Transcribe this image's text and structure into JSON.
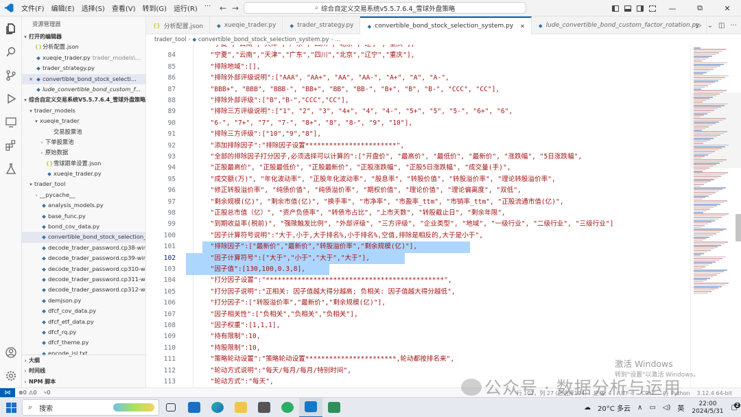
{
  "titlebar": {
    "menus": [
      "文件(F)",
      "编辑(E)",
      "选择(S)",
      "查看(V)",
      "转到(G)",
      "运行(R)",
      "···"
    ],
    "command_center": "综合自定义交易系统v5.5.7.6.4_雪球外盘策略",
    "window_controls": [
      "—",
      "⧉",
      "✕"
    ]
  },
  "sidebar": {
    "title": "资源管理器",
    "open_editors_label": "打开的编辑器",
    "open_editors": [
      {
        "icon": "{}",
        "name": "分析配置.json",
        "hint": "",
        "italic": false
      },
      {
        "icon": "py",
        "name": "xueqie_trader.py",
        "hint": "trader_models\\...",
        "italic": false
      },
      {
        "icon": "py",
        "name": "trader_strategy.py",
        "hint": "",
        "italic": false
      },
      {
        "icon": "py",
        "name": "convertible_bond_stock_selecti...",
        "hint": "",
        "italic": false,
        "selected": true,
        "close": "✕"
      },
      {
        "icon": "py",
        "name": "lude_convertible_bond_custom_f...",
        "hint": "",
        "italic": true
      }
    ],
    "workspace_label": "综合自定义交易系统V5.5.7.6.4_雪球外盘策略",
    "tree": [
      {
        "indent": 1,
        "type": "folder",
        "open": true,
        "name": "trader_models"
      },
      {
        "indent": 2,
        "type": "folder",
        "open": true,
        "name": "xueqie_trader"
      },
      {
        "indent": 3,
        "type": "text",
        "name": "交易股票池"
      },
      {
        "indent": 3,
        "type": "folder",
        "open": false,
        "name": "下单股票池"
      },
      {
        "indent": 3,
        "type": "folder",
        "open": false,
        "name": "原始数据"
      },
      {
        "indent": 3,
        "type": "json",
        "name": "雪球跟单设置.json"
      },
      {
        "indent": 3,
        "type": "py",
        "name": "xueqie_trader.py"
      },
      {
        "indent": 1,
        "type": "folder",
        "open": true,
        "name": "trader_tool"
      },
      {
        "indent": 2,
        "type": "folder",
        "open": false,
        "name": "__pycache__"
      },
      {
        "indent": 2,
        "type": "py",
        "name": "analysis_models.py"
      },
      {
        "indent": 2,
        "type": "py",
        "name": "base_func.py"
      },
      {
        "indent": 2,
        "type": "py",
        "name": "bond_cov_data.py"
      },
      {
        "indent": 2,
        "type": "py",
        "name": "convertible_bond_stock_selection_s...",
        "selected": true
      },
      {
        "indent": 2,
        "type": "py",
        "name": "decode_trader_password.cp38-win_..."
      },
      {
        "indent": 2,
        "type": "py",
        "name": "decode_trader_password.cp39-win_..."
      },
      {
        "indent": 2,
        "type": "py",
        "name": "decode_trader_password.cp310-wi..."
      },
      {
        "indent": 2,
        "type": "py",
        "name": "decode_trader_password.cp311-wi..."
      },
      {
        "indent": 2,
        "type": "py",
        "name": "decode_trader_password.cp312-wi..."
      },
      {
        "indent": 2,
        "type": "py",
        "name": "demjson.py"
      },
      {
        "indent": 2,
        "type": "py",
        "name": "dfcf_cov_data.py"
      },
      {
        "indent": 2,
        "type": "py",
        "name": "dfcf_etf_data.py"
      },
      {
        "indent": 2,
        "type": "py",
        "name": "dfcf_rq.py"
      },
      {
        "indent": 2,
        "type": "py",
        "name": "dfcf_theme.py"
      },
      {
        "indent": 2,
        "type": "py",
        "name": "encode_isl.txt"
      }
    ],
    "bottom_sections": [
      "大纲",
      "时间线",
      "NPM 脚本"
    ]
  },
  "tabs": [
    {
      "icon": "{}",
      "label": "分析配置.json",
      "active": false,
      "italic": false
    },
    {
      "icon": "py",
      "label": "xueqie_trader.py",
      "active": false,
      "italic": false
    },
    {
      "icon": "py",
      "label": "trader_strategy.py",
      "active": false,
      "italic": false
    },
    {
      "icon": "py",
      "label": "convertible_bond_stock_selection_system.py",
      "active": true,
      "italic": false,
      "close": "✕"
    },
    {
      "icon": "py",
      "label": "lude_convertible_bond_custom_factor_rotation.py",
      "active": false,
      "italic": true
    }
  ],
  "breadcrumb": {
    "folder": "trader_tool",
    "file": "convertible_bond_stock_selection_system.py",
    "symbol": "..."
  },
  "code": {
    "current_line": 102,
    "lines": [
      {
        "n": "",
        "text": "  \"宁夏\",\"云南\",\"天津\",\"广东\",\"四川\",\"北京\",\"辽宁\",\"重庆\"],"
      },
      {
        "n": 84,
        "text": "  \"宁夏\",\"云南\",\"天津\",\"广东\",\"四川\",\"北京\",\"辽宁\",\"重庆\"],"
      },
      {
        "n": 85,
        "text": "  \"排除地域\":[],"
      },
      {
        "n": 86,
        "text": "  \"排除外部评级说明\":[\"AAA\", \"AA+\", \"AA\", \"AA-\", \"A+\", \"A\", \"A-\","
      },
      {
        "n": 87,
        "text": "  \"BBB+\", \"BBB\", \"BBB-\", \"BB+\", \"BB\", \"BB-\", \"B+\", \"B\", \"B-\", \"CCC\", \"CC\"],"
      },
      {
        "n": 88,
        "text": "  \"排除外部评级\":[\"B\",\"B-\",\"CCC\",\"CC\"],"
      },
      {
        "n": 89,
        "text": "  \"排除三方评级说明\":[\"1\", \"2\", \"3\", \"4+\", \"4\", \"4-\", \"5+\", \"5\", \"5-\", \"6+\", \"6\","
      },
      {
        "n": 90,
        "text": "  \"6-\", \"7+\", \"7\", \"7-\", \"8+\", \"8\", \"8-\", \"9\", \"10\"],"
      },
      {
        "n": 91,
        "text": "  \"排除三方评级\":[\"10\",\"9\",\"8\"],"
      },
      {
        "n": 92,
        "text": "  \"添加排除因子\":\"排除因子设置***********************\","
      },
      {
        "n": 93,
        "text": "  \"全部的排除因子打分因子,必须选择可以计算的\":[\"开盘价\", \"最高价\", \"最低价\", \"最新价\", \"涨跌幅\", \"5日涨跌幅\","
      },
      {
        "n": 94,
        "text": "  \"正股最高价\", \"正股最低价\", \"正股最新价\", \"正股涨跌幅\", \"正股5日涨跌幅\", \"成交量(手)\","
      },
      {
        "n": 95,
        "text": "  \"成交额(万)\", \"年化波动率\", \"正股年化波动率\", \"股息率\", \"转股价值\", \"转股溢价率\", \"理论转股溢价率\","
      },
      {
        "n": 96,
        "text": "  \"修正转股溢价率\", \"纯债价值\", \"纯债溢价率\", \"期权价值\", \"理论价值\", \"理论偏离度\", \"双低\","
      },
      {
        "n": 97,
        "text": "  \"剩余规模(亿)\", \"剩余市值(亿)\", \"换手率\", \"市净率\", \"市盈率_ttm\", \"市销率_ttm\", \"正股流通市值(亿)\","
      },
      {
        "n": 98,
        "text": "  \"正股总市值（亿）\", \"资产负债率\", \"转债市占比\", \"上市天数\", \"转股截止日\", \"剩余年限\","
      },
      {
        "n": 99,
        "text": "  \"到期收益率(税前)\", \"强赎触发比例\", \"外部评级\", \"三方评级\", \"企业类型\", \"地域\", \"一级行业\", \"二级行业\", \"三级行业\"]"
      },
      {
        "n": 100,
        "text": "  \"因子计算符号说明\":\"大于,小于,大于排名%,小于排名%,空值,排除是相反的,大于是小于\","
      },
      {
        "n": 101,
        "text": "  \"排除因子\":[\"最新价\",\"最新价\",\"转股溢价率\",\"剩余规模(亿)\"],"
      },
      {
        "n": 102,
        "text": "  \"因子计算符号\":[\"大于\",\"小于\",\"大于\",\"大于\"],"
      },
      {
        "n": 103,
        "text": "  \"因子值\":[130,100,0.3,8],"
      },
      {
        "n": 104,
        "text": "  \"打分因子设置\":\"*********************************************\","
      },
      {
        "n": 105,
        "text": "  \"打分因子说明\":\"正相关: 因子值越大得分越高; 负相关: 因子值越大得分越低\","
      },
      {
        "n": 106,
        "text": "  \"打分因子\":[\"转股溢价率\",\"最新价\",\"剩余规模(亿)\"],"
      },
      {
        "n": 107,
        "text": "  \"因子相关性\":[\"负相关\",\"负相关\",\"负相关\"],"
      },
      {
        "n": 108,
        "text": "  \"因子权重\":[1,1,1],"
      },
      {
        "n": 109,
        "text": "  \"持有限制\":10,"
      },
      {
        "n": 110,
        "text": "  \"持股限制\":10,"
      },
      {
        "n": 111,
        "text": "  \"策略轮动设置\":\"策略轮动设置***********************,轮动都按排名来\","
      },
      {
        "n": 112,
        "text": "  \"轮动方式说明\":\"每天/每月/每月/特别时间\","
      },
      {
        "n": 113,
        "text": "  \"轮动方式\":\"每天\","
      },
      {
        "n": 114,
        "text": "  \"说明\":\"每天按自定义函数运行\","
      }
    ]
  },
  "status": {
    "remote": "⋈",
    "errors": "⊗0 ⚠0",
    "ports": "⑂0",
    "position": "行 102，列 27 (已选择104)",
    "spaces": "空格: 4",
    "encoding": "UTF-8",
    "eol": "CRLF",
    "language": "{} Python",
    "interpreter": "3.12.4 64-bit"
  },
  "watermark": {
    "activate_title": "激活 Windows",
    "activate_sub": "转到\"设置\"以激活 Windows。",
    "wechat": "公众号 · 数据分析与运用"
  },
  "taskbar": {
    "search_placeholder": "搜索",
    "weather": "20°C 多云",
    "ime": "英",
    "time": "22:00",
    "date": "2024/5/31",
    "notification_count": "2"
  }
}
